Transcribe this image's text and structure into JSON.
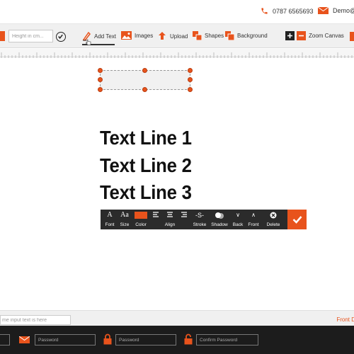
{
  "header": {
    "phone": "0787 6565693",
    "email": "Demo@1"
  },
  "toolbar": {
    "height_placeholder": "Height in cm...",
    "tools": [
      {
        "label": "Add Text",
        "icon": "add-text-icon"
      },
      {
        "label": "Images",
        "icon": "image-icon"
      },
      {
        "label": "Upload",
        "icon": "upload-icon"
      },
      {
        "label": "Shapes",
        "icon": "shapes-icon"
      },
      {
        "label": "Background",
        "icon": "background-icon"
      }
    ],
    "zoom_label": "Zoom Canvas",
    "active_tool": "Add Text"
  },
  "canvas": {
    "lines": [
      "Text Line 1",
      "Text Line 2",
      "Text Line 3"
    ],
    "selected_line": "Text Line 1"
  },
  "text_toolbar": {
    "items": [
      {
        "label": "Font",
        "icon": "font-icon"
      },
      {
        "label": "Size",
        "icon": "size-icon"
      },
      {
        "label": "Color",
        "icon": "color-swatch"
      },
      {
        "label": "Align",
        "icon": "align-icon"
      },
      {
        "label": "Stroke",
        "icon": "stroke-icon"
      },
      {
        "label": "Shadow",
        "icon": "shadow-icon"
      },
      {
        "label": "Back",
        "icon": "send-back-icon"
      },
      {
        "label": "Front",
        "icon": "bring-front-icon"
      },
      {
        "label": "Delete",
        "icon": "delete-icon"
      }
    ],
    "color_value": "#e8531c"
  },
  "bottom": {
    "name_placeholder": "me input text is here",
    "front_label": "Front D"
  },
  "footer": {
    "email_placeholder": "Password",
    "password_placeholder": "Password",
    "confirm_placeholder": "Confirm Password"
  },
  "colors": {
    "accent": "#e8531c",
    "toolbar_dark": "#2b2b2b",
    "footer": "#1c1c1c"
  }
}
